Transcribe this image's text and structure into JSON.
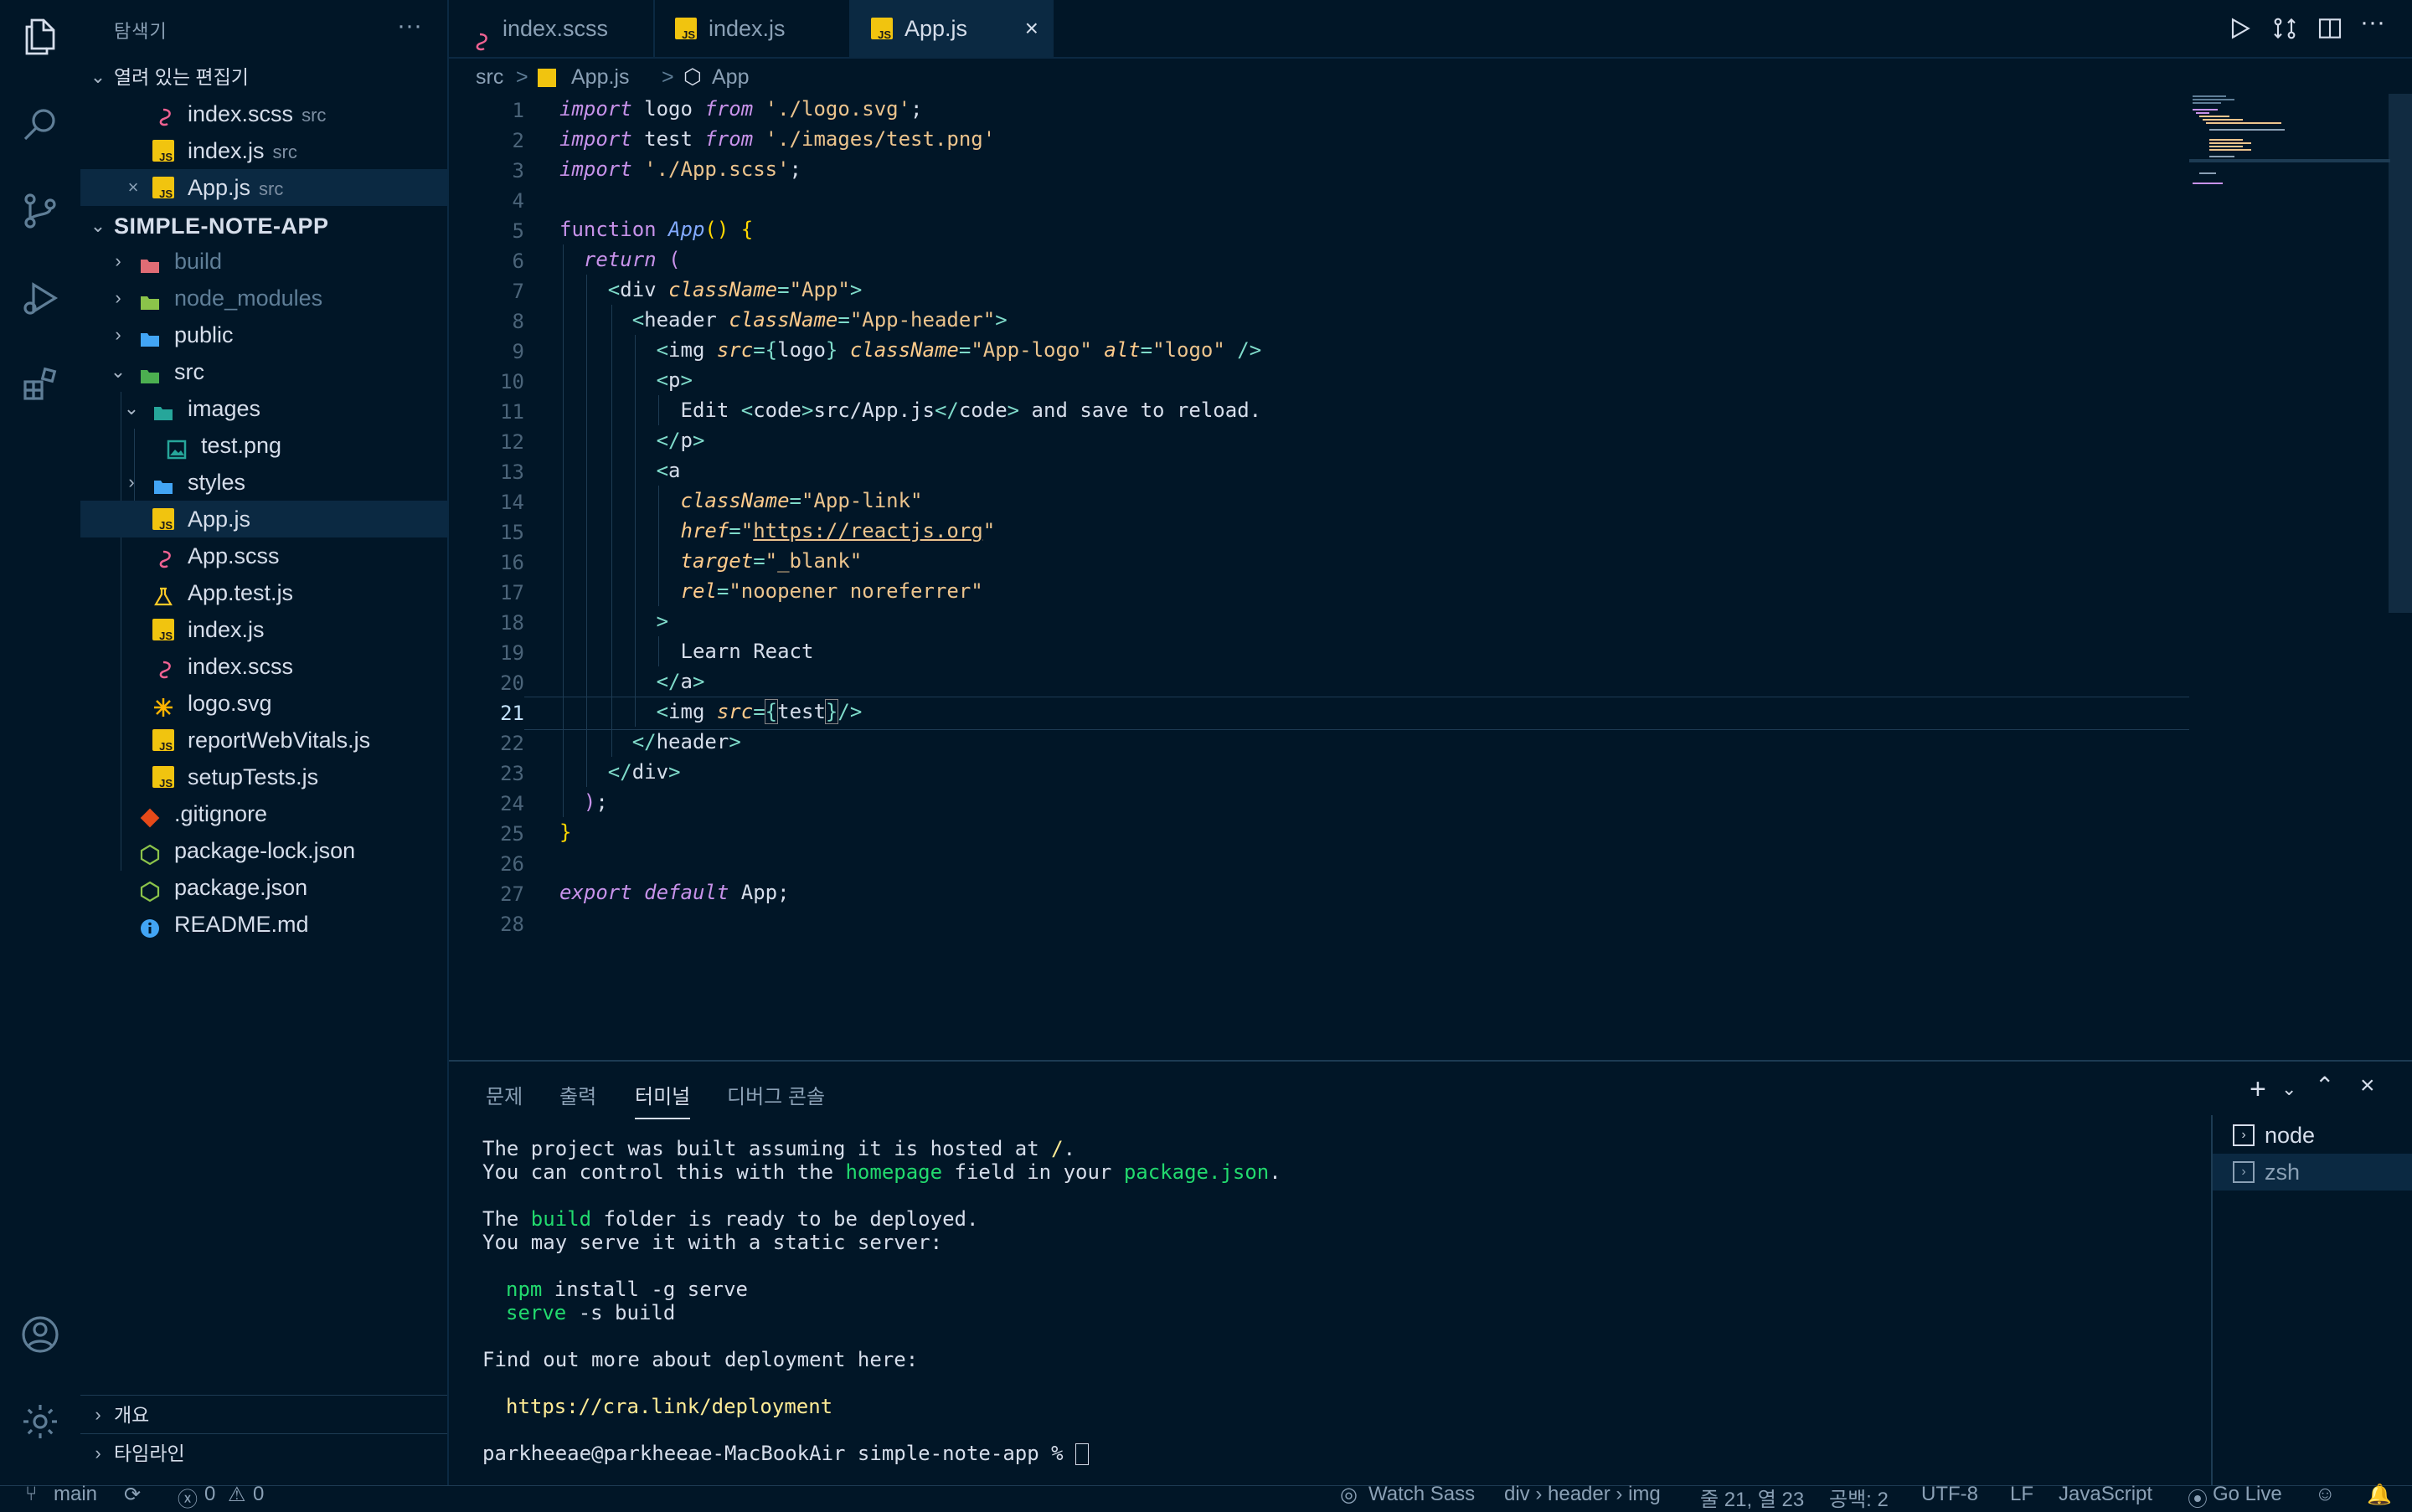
{
  "sidebar": {
    "title": "탐색기",
    "more": "···",
    "open_editors": {
      "header": "열려 있는 편집기",
      "items": [
        {
          "name": "index.scss",
          "hint": "src"
        },
        {
          "name": "index.js",
          "hint": "src"
        },
        {
          "name": "App.js",
          "hint": "src"
        }
      ]
    },
    "project": {
      "header": "SIMPLE-NOTE-APP",
      "items": [
        "build",
        "node_modules",
        "public",
        "src",
        "images",
        "test.png",
        "styles",
        "App.js",
        "App.scss",
        "App.test.js",
        "index.js",
        "index.scss",
        "logo.svg",
        "reportWebVitals.js",
        "setupTests.js",
        ".gitignore",
        "package-lock.json",
        "package.json",
        "README.md"
      ]
    },
    "outline": "개요",
    "timeline": "타임라인"
  },
  "tabs": [
    {
      "label": "index.scss"
    },
    {
      "label": "index.js"
    },
    {
      "label": "App.js",
      "close": "×"
    }
  ],
  "breadcrumb": {
    "folder": "src",
    "file": "App.js",
    "symbol": "App",
    "sep": ">"
  },
  "editor": {
    "current_line": 21,
    "lines": [
      "1",
      "2",
      "3",
      "4",
      "5",
      "6",
      "7",
      "8",
      "9",
      "10",
      "11",
      "12",
      "13",
      "14",
      "15",
      "16",
      "17",
      "18",
      "19",
      "20",
      "21",
      "22",
      "23",
      "24",
      "25",
      "26",
      "27",
      "28"
    ]
  },
  "panel": {
    "tabs": [
      "문제",
      "출력",
      "터미널",
      "디버그 콘솔"
    ],
    "active_tab": "터미널",
    "terminal": {
      "l1a": "The project was built assuming it is hosted at ",
      "l1b": "/",
      "l1c": ".",
      "l2a": "You can control this with the ",
      "l2b": "homepage",
      "l2c": " field in your ",
      "l2d": "package.json",
      "l2e": ".",
      "l3a": "The ",
      "l3b": "build",
      "l3c": " folder is ready to be deployed.",
      "l4": "You may serve it with a static server:",
      "l5a": "npm",
      "l5b": " install -g serve",
      "l6a": "serve",
      "l6b": " -s build",
      "l7": "Find out more about deployment here:",
      "l8": "https://cra.link/deployment",
      "prompt": "parkheeae@parkheeae-MacBookAir simple-note-app % "
    },
    "terminals": [
      "node",
      "zsh"
    ]
  },
  "status": {
    "branch": "main",
    "errors": "0",
    "warnings": "0",
    "watch_sass": "Watch Sass",
    "path": "div › header › img",
    "position": "줄 21, 열 23",
    "spaces": "공백: 2",
    "encoding": "UTF-8",
    "eol": "LF",
    "language": "JavaScript",
    "golive": "Go Live"
  },
  "colors": {
    "background": "#011627",
    "selection": "#0b2942",
    "accent": "#82aaff"
  }
}
